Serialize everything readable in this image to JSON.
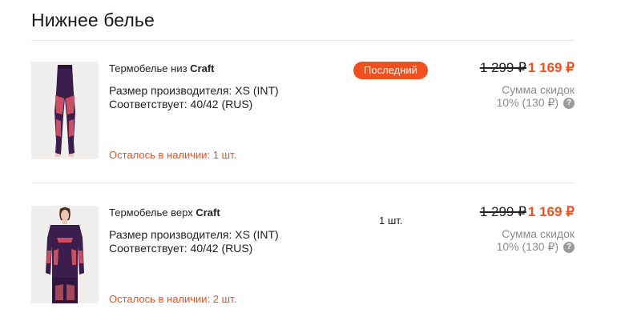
{
  "section": {
    "title": "Нижнее белье"
  },
  "items": [
    {
      "name_prefix": "Термобелье низ",
      "brand": "Craft",
      "size_label": "Размер производителя: XS (INT)",
      "fit_label": "Соответствует: 40/42 (RUS)",
      "stock_label": "Осталось в наличии:  1  шт.",
      "badge": "Последний",
      "old_price": "1 299 ₽",
      "new_price": "1 169 ₽",
      "discount_label": "Сумма скидок",
      "discount_value": "10% (130 ₽)",
      "image_icon": "thermal-leggings-image"
    },
    {
      "name_prefix": "Термобелье верх",
      "brand": "Craft",
      "size_label": "Размер производителя: XS (INT)",
      "fit_label": "Соответствует: 40/42 (RUS)",
      "stock_label": "Осталось в наличии:  2  шт.",
      "quantity": "1 шт.",
      "old_price": "1 299 ₽",
      "new_price": "1 169 ₽",
      "discount_label": "Сумма скидок",
      "discount_value": "10% (130 ₽)",
      "image_icon": "thermal-top-image"
    }
  ],
  "colors": {
    "accent": "#f0501f",
    "muted": "#8c8c8c",
    "divider": "#e6e6e6"
  }
}
